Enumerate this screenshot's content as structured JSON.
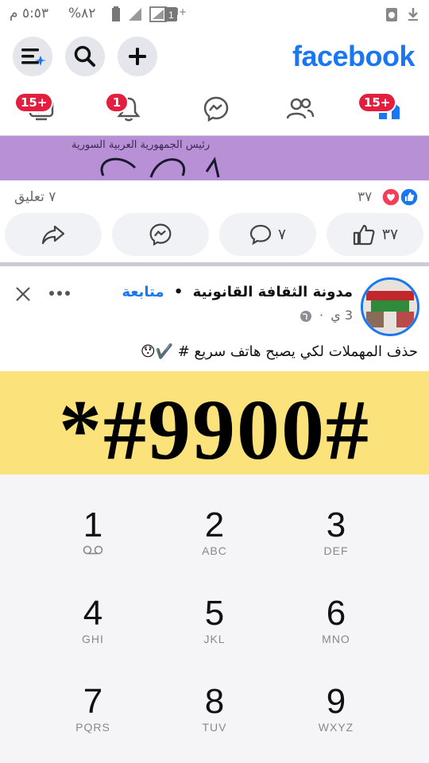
{
  "status_bar": {
    "time": "٥:٥٣ م",
    "battery": "%٨٢"
  },
  "header": {
    "logo": "facebook"
  },
  "nav": {
    "video_badge": "15+",
    "notifications_badge": "1",
    "home_badge": "15+"
  },
  "prev_post": {
    "image_caption": "رئيس الجمهورية العربية السورية",
    "comments_count": "٧ تعليق",
    "reactions_count": "٣٧",
    "like_count": "٣٧",
    "comment_count": "٧"
  },
  "post": {
    "page_name": "مدونة الثقافة القانونية",
    "separator": "•",
    "follow_label": "متابعة",
    "time": "3 ي",
    "time_dot": "·",
    "text": "حذف المهملات لكي يصبح هاتف سريع #",
    "emoji": "✔️😯",
    "banner_code": "*#9900#"
  },
  "dialpad": {
    "keys": [
      {
        "digit": "1",
        "letters": ""
      },
      {
        "digit": "2",
        "letters": "ABC"
      },
      {
        "digit": "3",
        "letters": "DEF"
      },
      {
        "digit": "4",
        "letters": "GHI"
      },
      {
        "digit": "5",
        "letters": "JKL"
      },
      {
        "digit": "6",
        "letters": "MNO"
      },
      {
        "digit": "7",
        "letters": "PQRS"
      },
      {
        "digit": "8",
        "letters": "TUV"
      },
      {
        "digit": "9",
        "letters": "WXYZ"
      }
    ]
  },
  "colors": {
    "brand": "#1877f2",
    "badge": "#e41e3f",
    "banner": "#fbe27a",
    "image_bg": "#b790d6"
  }
}
